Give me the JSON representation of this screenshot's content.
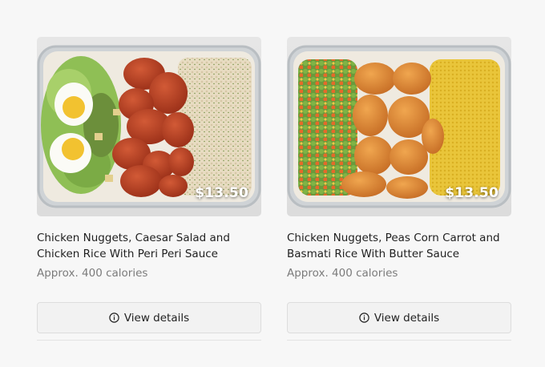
{
  "products": [
    {
      "title": "Chicken Nuggets, Caesar Salad and Chicken Rice With Peri Peri Sauce",
      "price": "$13.50",
      "calories": "Approx. 400 calories",
      "button_label": "View details"
    },
    {
      "title": "Chicken Nuggets, Peas Corn Carrot and Basmati Rice With Butter Sauce",
      "price": "$13.50",
      "calories": "Approx. 400 calories",
      "button_label": "View details"
    }
  ],
  "icons": {
    "details": "info-circle-icon"
  }
}
